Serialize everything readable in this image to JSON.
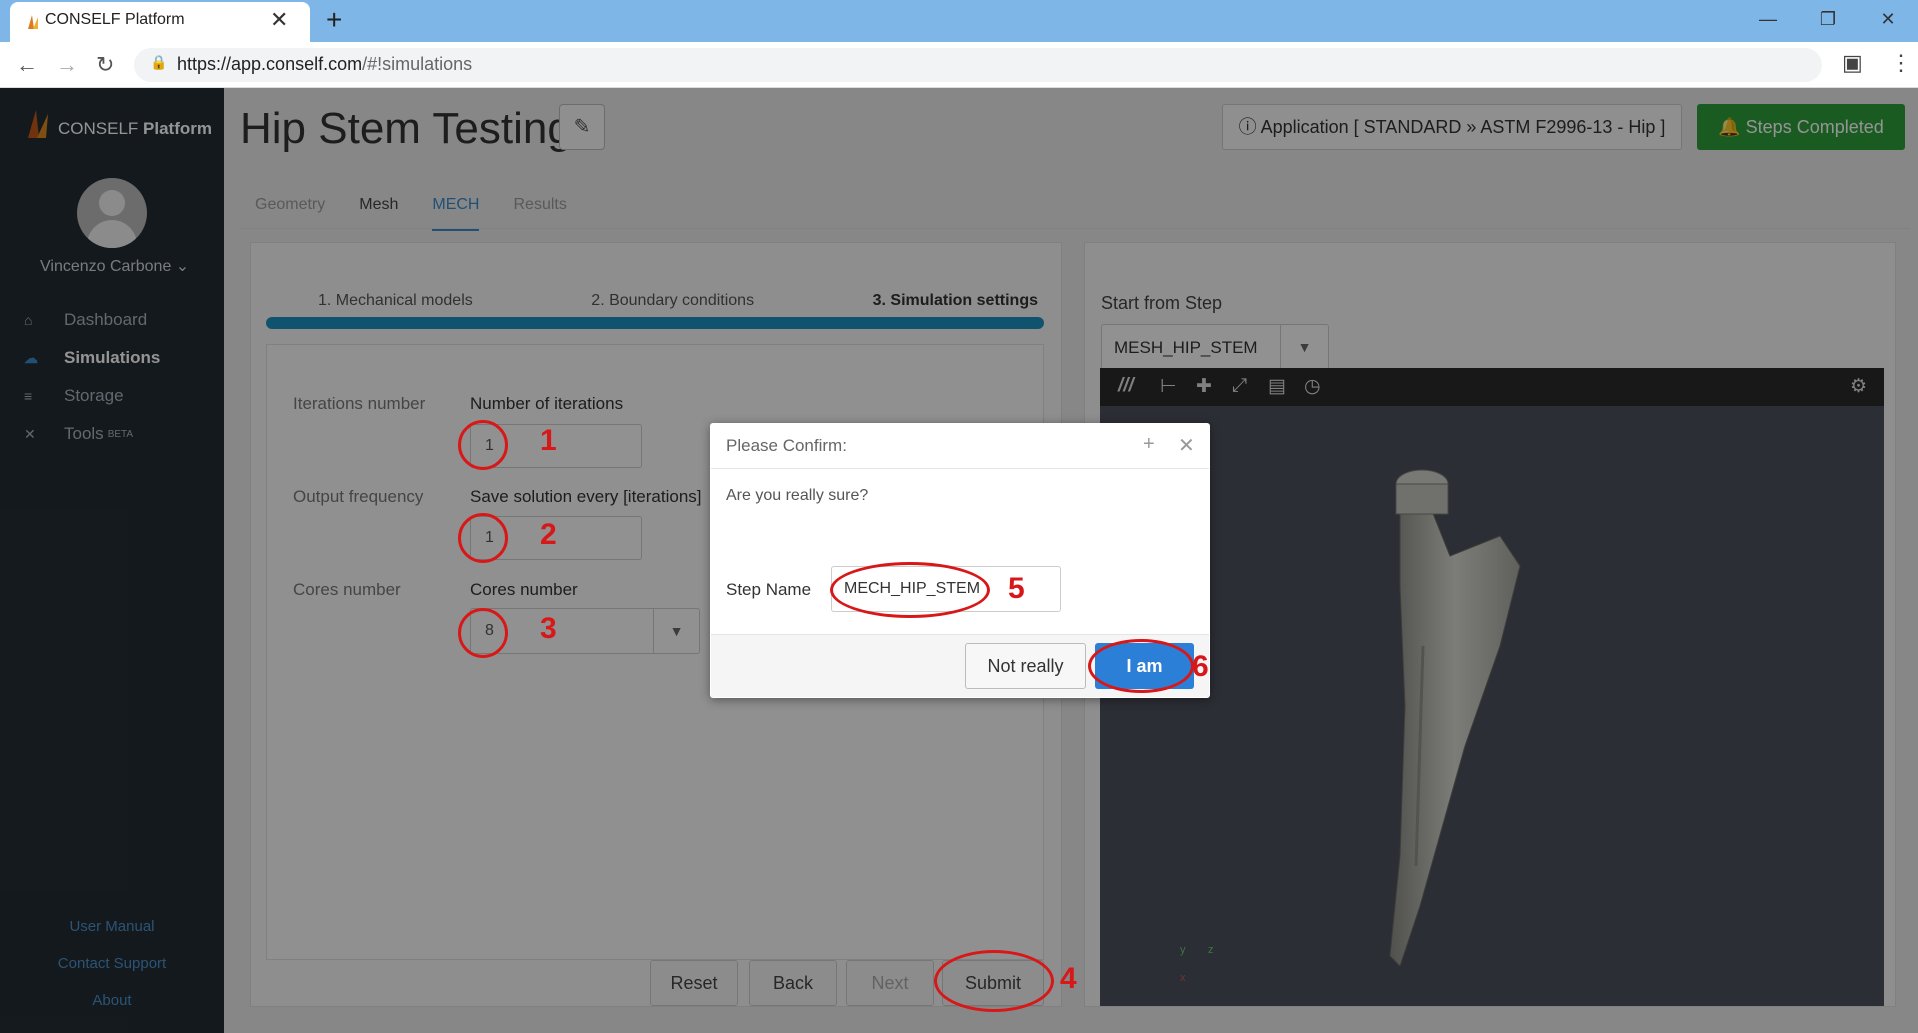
{
  "browser": {
    "tab_title": "CONSELF Platform",
    "tab_close": "✕",
    "new_tab": "+",
    "url_host": "https://app.conself.com",
    "url_path": "/#!simulations",
    "window_controls": [
      "—",
      "❐",
      "✕"
    ]
  },
  "sidebar": {
    "brand_plain": "CONSELF",
    "brand_bold": "Platform",
    "user": "Vincenzo Carbone ⌄",
    "items": [
      {
        "label": "Dashboard",
        "icon": "home-icon"
      },
      {
        "label": "Simulations",
        "icon": "cloud-icon"
      },
      {
        "label": "Storage",
        "icon": "database-icon"
      },
      {
        "label": "Tools",
        "icon": "wrench-icon",
        "badge": "BETA"
      }
    ],
    "footer_links": [
      "User Manual",
      "Contact Support",
      "About"
    ]
  },
  "header": {
    "title": "Hip Stem Testing",
    "application": "ⓘ Application [ STANDARD » ASTM F2996-13 - Hip ]",
    "steps_completed": "🔔 Steps Completed"
  },
  "tabs": [
    "Geometry",
    "Mesh",
    "MECH",
    "Results"
  ],
  "wizard": {
    "steps": [
      "1. Mechanical models",
      "2. Boundary conditions",
      "3. Simulation settings"
    ]
  },
  "form": {
    "iterations_label": "Iterations number",
    "iterations_header": "Number of iterations",
    "iterations_value": "1",
    "output_label": "Output frequency",
    "output_header": "Save solution every [iterations]",
    "output_value": "1",
    "cores_label": "Cores number",
    "cores_header": "Cores number",
    "cores_value": "8",
    "buttons": {
      "reset": "Reset",
      "back": "Back",
      "next": "Next",
      "submit": "Submit"
    }
  },
  "right": {
    "start_from_step_label": "Start from Step",
    "start_from_step_value": "MESH_HIP_STEM",
    "axes": {
      "y": "y",
      "z": "z",
      "x": "x"
    }
  },
  "modal": {
    "title": "Please Confirm:",
    "message": "Are you really sure?",
    "step_name_label": "Step Name",
    "step_name_value": "MECH_HIP_STEM",
    "not_really": "Not really",
    "i_am": "I am"
  },
  "annotations": [
    "1",
    "2",
    "3",
    "4",
    "5",
    "6"
  ],
  "colors": {
    "accent": "#1a8fbf",
    "success": "#2e9e3c",
    "primary": "#2b7fd6",
    "annotation": "#d81818"
  }
}
